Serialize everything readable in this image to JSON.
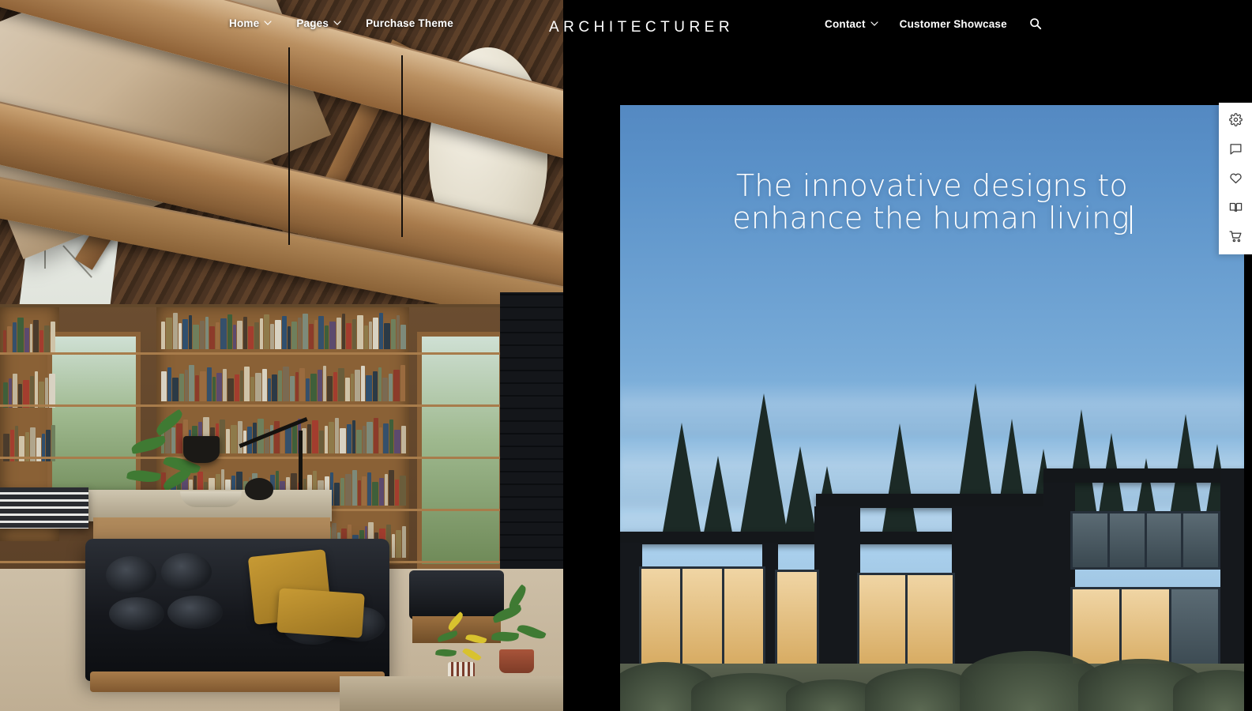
{
  "site": {
    "brand": "ARCHITECTURER"
  },
  "nav": {
    "left_items": [
      {
        "label": "Home",
        "has_dropdown": true,
        "icon": "chevron-down-icon"
      },
      {
        "label": "Pages",
        "has_dropdown": true,
        "icon": "chevron-down-icon"
      },
      {
        "label": "Purchase Theme",
        "has_dropdown": false,
        "icon": ""
      }
    ],
    "right_items": [
      {
        "label": "Contact",
        "has_dropdown": true,
        "icon": "chevron-down-icon"
      },
      {
        "label": "Customer Showcase",
        "has_dropdown": false,
        "icon": ""
      }
    ],
    "search_icon": "search-icon"
  },
  "hero": {
    "headline_line1": "The innovative designs to",
    "headline_line2": "enhance the human  living",
    "caret_visible": true,
    "background_alt": "modern-house-at-dusk-photo",
    "sky_top_color": "#5b92c9",
    "sky_horizon_color": "#a9cfec"
  },
  "left_panel": {
    "image_alt": "wooden-library-interior-with-beams-photo"
  },
  "toolpanel": {
    "buttons": [
      {
        "name": "settings-icon",
        "title": "Settings"
      },
      {
        "name": "chat-bubble-icon",
        "title": "Chat"
      },
      {
        "name": "heart-icon",
        "title": "Wishlist"
      },
      {
        "name": "book-icon",
        "title": "Documentation"
      },
      {
        "name": "shopping-cart-icon",
        "title": "Cart"
      }
    ],
    "background_color": "#ffffff"
  },
  "colors": {
    "nav_background": "#000000",
    "nav_text": "#ffffff",
    "page_background": "#000000"
  }
}
